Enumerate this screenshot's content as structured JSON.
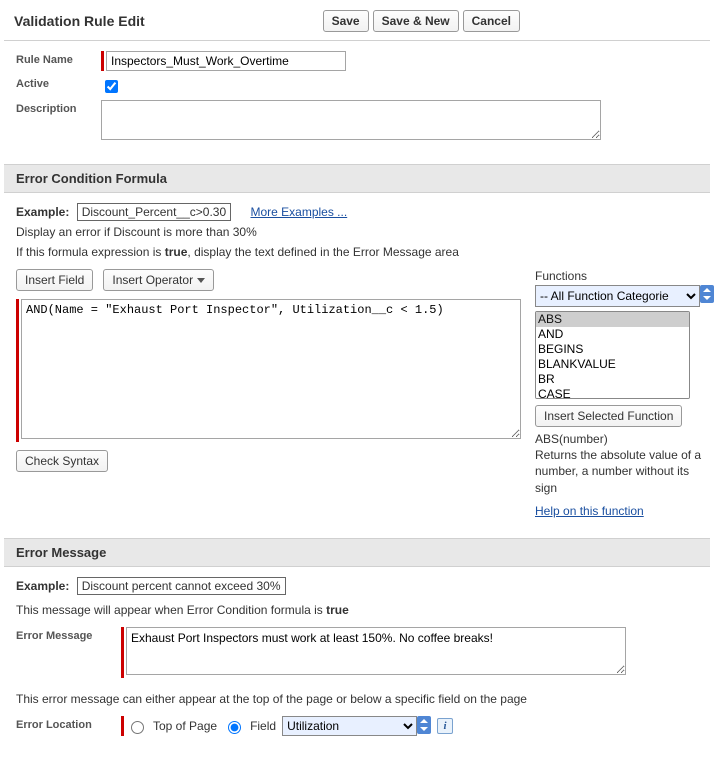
{
  "header": {
    "title": "Validation Rule Edit",
    "save": "Save",
    "saveNew": "Save & New",
    "cancel": "Cancel"
  },
  "rule": {
    "nameLabel": "Rule Name",
    "nameValue": "Inspectors_Must_Work_Overtime",
    "activeLabel": "Active",
    "activeChecked": true,
    "descriptionLabel": "Description",
    "descriptionValue": ""
  },
  "formulaSection": {
    "title": "Error Condition Formula",
    "exampleLabel": "Example:",
    "exampleText": "Discount_Percent__c>0.30",
    "moreExamples": "More Examples ...",
    "exampleDesc": "Display an error if Discount is more than 30%",
    "trueDesc1": "If this formula expression is ",
    "trueWord": "true",
    "trueDesc2": ", display the text defined in the Error Message area",
    "insertField": "Insert Field",
    "insertOperator": "Insert Operator",
    "formula": "AND(Name = \"Exhaust Port Inspector\", Utilization__c < 1.5)",
    "checkSyntax": "Check Syntax",
    "functionsLabel": "Functions",
    "categorySelected": "-- All Function Categorie",
    "funcList": [
      "ABS",
      "AND",
      "BEGINS",
      "BLANKVALUE",
      "BR",
      "CASE"
    ],
    "insertSelectedFunction": "Insert Selected Function",
    "funcSig": "ABS(number)",
    "funcDesc": "Returns the absolute value of a number, a number without its sign",
    "helpLink": "Help on this function"
  },
  "messageSection": {
    "title": "Error Message",
    "exampleLabel": "Example:",
    "exampleText": "Discount percent cannot exceed 30%",
    "desc1": "This message will appear when Error Condition formula is ",
    "descTrue": "true",
    "errorMessageLabel": "Error Message",
    "errorMessageValue": "Exhaust Port Inspectors must work at least 150%. No coffee breaks!",
    "locationDesc": "This error message can either appear at the top of the page or below a specific field on the page",
    "errorLocationLabel": "Error Location",
    "topOfPage": "Top of Page",
    "field": "Field",
    "fieldSelected": "Utilization"
  }
}
